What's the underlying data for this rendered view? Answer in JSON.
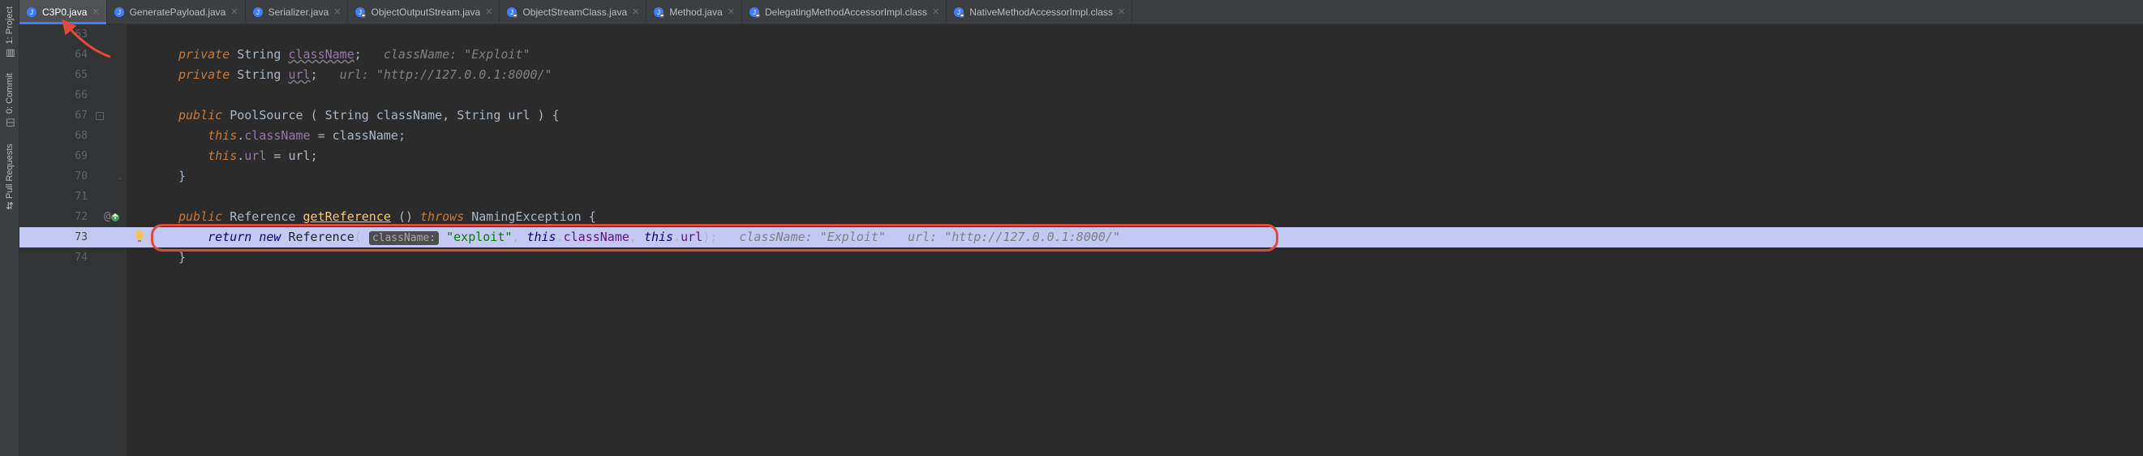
{
  "rail": {
    "project": "1: Project",
    "commit": "0: Commit",
    "pull": "Pull Requests"
  },
  "tabs": [
    {
      "label": "C3P0.java",
      "active": true,
      "icon": "java"
    },
    {
      "label": "GeneratePayload.java",
      "active": false,
      "icon": "java"
    },
    {
      "label": "Serializer.java",
      "active": false,
      "icon": "java"
    },
    {
      "label": "ObjectOutputStream.java",
      "active": false,
      "icon": "java-lock"
    },
    {
      "label": "ObjectStreamClass.java",
      "active": false,
      "icon": "java-lock"
    },
    {
      "label": "Method.java",
      "active": false,
      "icon": "java-lock"
    },
    {
      "label": "DelegatingMethodAccessorImpl.class",
      "active": false,
      "icon": "java-lock"
    },
    {
      "label": "NativeMethodAccessorImpl.class",
      "active": false,
      "icon": "java-lock"
    }
  ],
  "ln": {
    "l63": "63",
    "l64": "64",
    "l65": "65",
    "l66": "66",
    "l67": "67",
    "l68": "68",
    "l69": "69",
    "l70": "70",
    "l71": "71",
    "l72": "72",
    "l73": "73",
    "l74": "74"
  },
  "code": {
    "kw_private": "private",
    "kw_public": "public",
    "kw_this": "this",
    "kw_return": "return",
    "kw_new": "new",
    "kw_throws": "throws",
    "t_String": "String",
    "t_PoolSource": "PoolSource",
    "t_Reference": "Reference",
    "t_NamingException": "NamingException",
    "f_className": "className",
    "f_url": "url",
    "m_getReference": "getReference",
    "p_className": "className",
    "p_url": "url",
    "hint_className": "className:",
    "hint_url": "url:",
    "s_exploit": "\"exploit\"",
    "s_Exploit": "\"Exploit\"",
    "s_httpurl": "\"http://127.0.0.1:8000/\"",
    "hint_className_lbl": "className: ",
    "hint_url_lbl": "url: ",
    "semi": ";",
    "comma": ", ",
    "eq": " = ",
    "dot": ".",
    "lp": "(",
    "rp": ")",
    "lb": " {",
    "rb": "}",
    "sp": " "
  }
}
